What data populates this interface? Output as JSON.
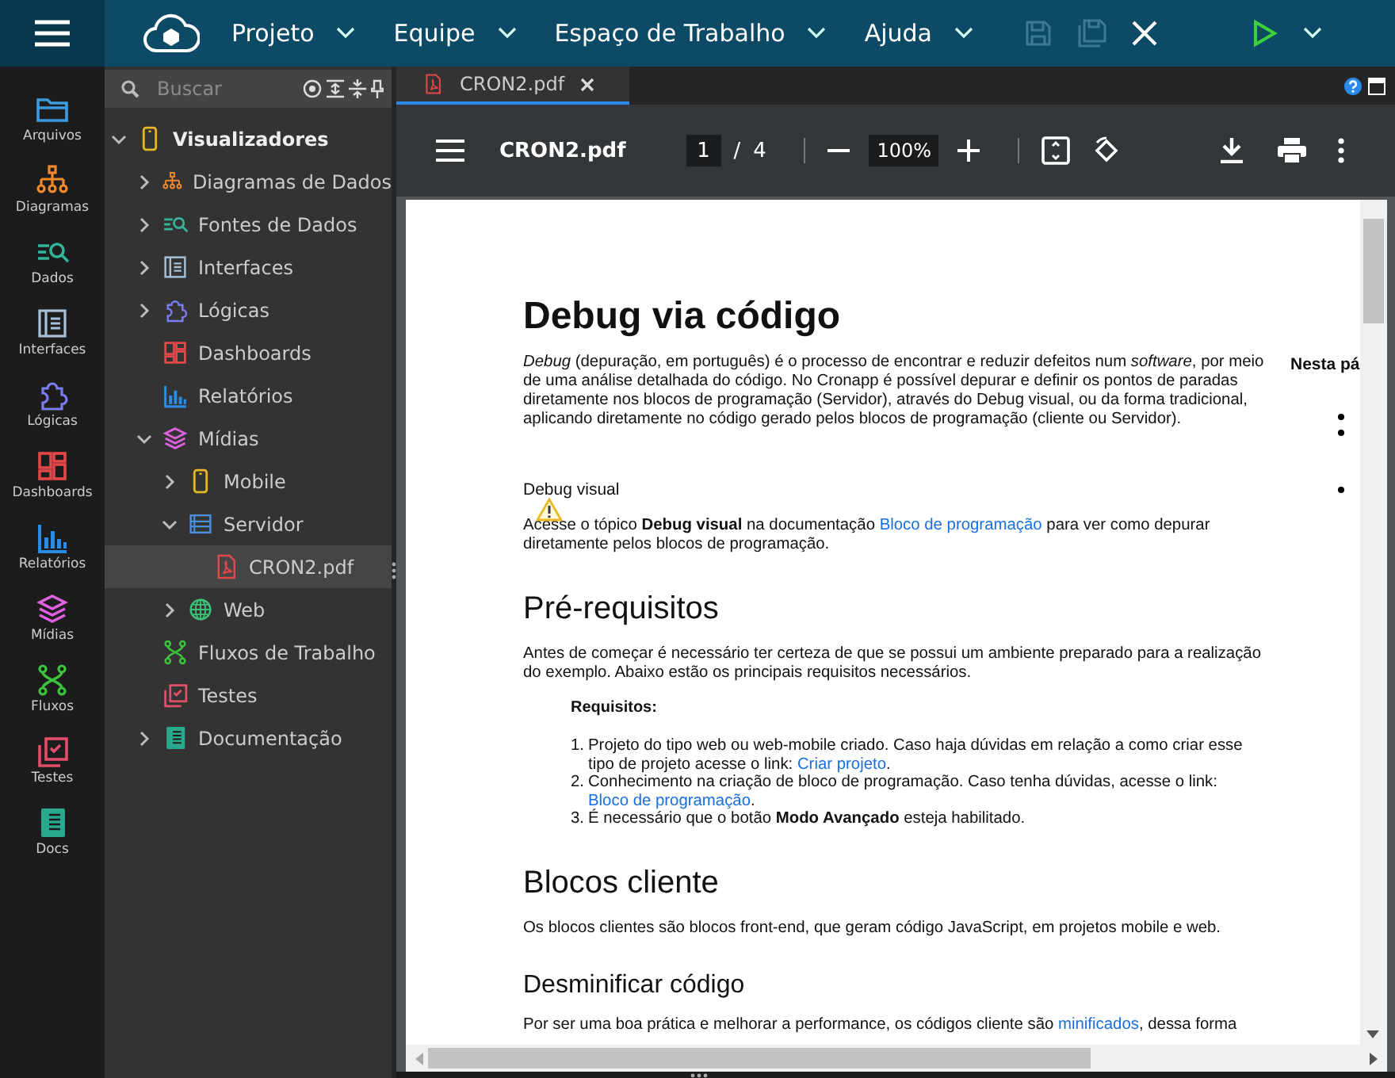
{
  "menu": [
    {
      "label": "Projeto"
    },
    {
      "label": "Equipe"
    },
    {
      "label": "Espaço de Trabalho"
    },
    {
      "label": "Ajuda"
    }
  ],
  "rail": [
    {
      "label": "Arquivos",
      "color": "#3d9be0"
    },
    {
      "label": "Diagramas",
      "color": "#f0892a"
    },
    {
      "label": "Dados",
      "color": "#33b59a"
    },
    {
      "label": "Interfaces",
      "color": "#a8c0d6"
    },
    {
      "label": "Lógicas",
      "color": "#7a7cf2"
    },
    {
      "label": "Dashboards",
      "color": "#e24848"
    },
    {
      "label": "Relatórios",
      "color": "#2b8ce6"
    },
    {
      "label": "Mídias",
      "color": "#e061e0"
    },
    {
      "label": "Fluxos",
      "color": "#3cc43c"
    },
    {
      "label": "Testes",
      "color": "#e04e6a"
    },
    {
      "label": "Docs",
      "color": "#2aa88e"
    }
  ],
  "search": {
    "placeholder": "Buscar"
  },
  "tree": [
    {
      "label": "Visualizadores",
      "expanded": true,
      "selected": false,
      "children": [
        {
          "label": "Diagramas de Dados",
          "expanded": false,
          "selected": false
        },
        {
          "label": "Fontes de Dados",
          "expanded": false,
          "selected": false
        },
        {
          "label": "Interfaces",
          "expanded": false,
          "selected": false
        },
        {
          "label": "Lógicas",
          "expanded": false,
          "selected": false
        },
        {
          "label": "Dashboards",
          "selected": false
        },
        {
          "label": "Relatórios",
          "selected": false
        },
        {
          "label": "Mídias",
          "expanded": true,
          "selected": false,
          "children": [
            {
              "label": "Mobile",
              "expanded": false,
              "selected": false
            },
            {
              "label": "Servidor",
              "expanded": true,
              "selected": false,
              "children": [
                {
                  "label": "CRON2.pdf",
                  "selected": true
                }
              ]
            },
            {
              "label": "Web",
              "expanded": false,
              "selected": false
            }
          ]
        },
        {
          "label": "Fluxos de Trabalho",
          "selected": false
        },
        {
          "label": "Testes",
          "selected": false
        },
        {
          "label": "Documentação",
          "expanded": false,
          "selected": false
        }
      ]
    }
  ],
  "tabs": [
    {
      "label": "CRON2.pdf",
      "selected": true
    }
  ],
  "pdf_toolbar": {
    "title": "CRON2.pdf",
    "page": "1",
    "separator": "/",
    "pages": "4",
    "zoom": "100%"
  },
  "document": {
    "side_heading": "Nesta pá",
    "blocks": [
      {
        "kind": "h1",
        "text": "Debug via código"
      },
      {
        "kind": "intro",
        "parts": [
          {
            "kind": "text",
            "text": "*Debug* (depuração, em português) é o processo de encontrar e reduzir defeitos num *software*, por meio de uma análise detalhada do código. No Cronapp é possível depurar e definir os pontos de paradas diretamente nos blocos de programação (Servidor), através do Debug visual, ou da forma tradicional, aplicando diretamente no código gerado pelos blocos de programação (cliente ou Servidor)."
          }
        ]
      },
      {
        "kind": "label",
        "text": "Debug visual"
      },
      {
        "kind": "p",
        "parts": [
          {
            "kind": "text",
            "text": "Acesse o tópico **Debug visual** na documentação "
          },
          {
            "kind": "link",
            "text": "Bloco de programação"
          },
          {
            "kind": "text",
            "text": " para ver como depurar diretamente pelos blocos de programação."
          }
        ]
      },
      {
        "kind": "h2",
        "text": "Pré-requisitos"
      },
      {
        "kind": "p",
        "parts": [
          {
            "kind": "text",
            "text": "Antes de começar é necessário ter certeza de que se possui um ambiente preparado para a realização do exemplo. Abaixo estão os principais requisitos necessários."
          }
        ]
      },
      {
        "kind": "strong",
        "text": "Requisitos:"
      },
      {
        "kind": "ol",
        "items": [
          {
            "number": "1.",
            "parts": [
              {
                "kind": "text",
                "text": "Projeto do tipo web ou web-mobile criado. Caso haja dúvidas em relação a como criar esse tipo de projeto acesse o link: "
              },
              {
                "kind": "link",
                "text": "Criar projeto"
              },
              {
                "kind": "text",
                "text": "."
              }
            ]
          },
          {
            "number": "2.",
            "parts": [
              {
                "kind": "text",
                "text": "Conhecimento na criação de bloco de programação. Caso tenha dúvidas, acesse o link: "
              },
              {
                "kind": "link",
                "text": "Bloco de programação"
              },
              {
                "kind": "text",
                "text": "."
              }
            ]
          },
          {
            "number": "3.",
            "parts": [
              {
                "kind": "text",
                "text": "É necessário que o botão **Modo Avançado** esteja habilitado."
              }
            ]
          }
        ]
      },
      {
        "kind": "h2",
        "text": "Blocos cliente"
      },
      {
        "kind": "p",
        "parts": [
          {
            "kind": "text",
            "text": "Os blocos clientes são blocos front-end, que geram código JavaScript, em projetos mobile e web."
          }
        ]
      },
      {
        "kind": "h3",
        "text": "Desminificar código"
      },
      {
        "kind": "p",
        "parts": [
          {
            "kind": "text",
            "text": "Por ser uma boa prática e melhorar a performance, os códigos cliente são "
          },
          {
            "kind": "link",
            "text": "minificados"
          },
          {
            "kind": "text",
            "text": ", dessa forma"
          }
        ]
      }
    ]
  }
}
